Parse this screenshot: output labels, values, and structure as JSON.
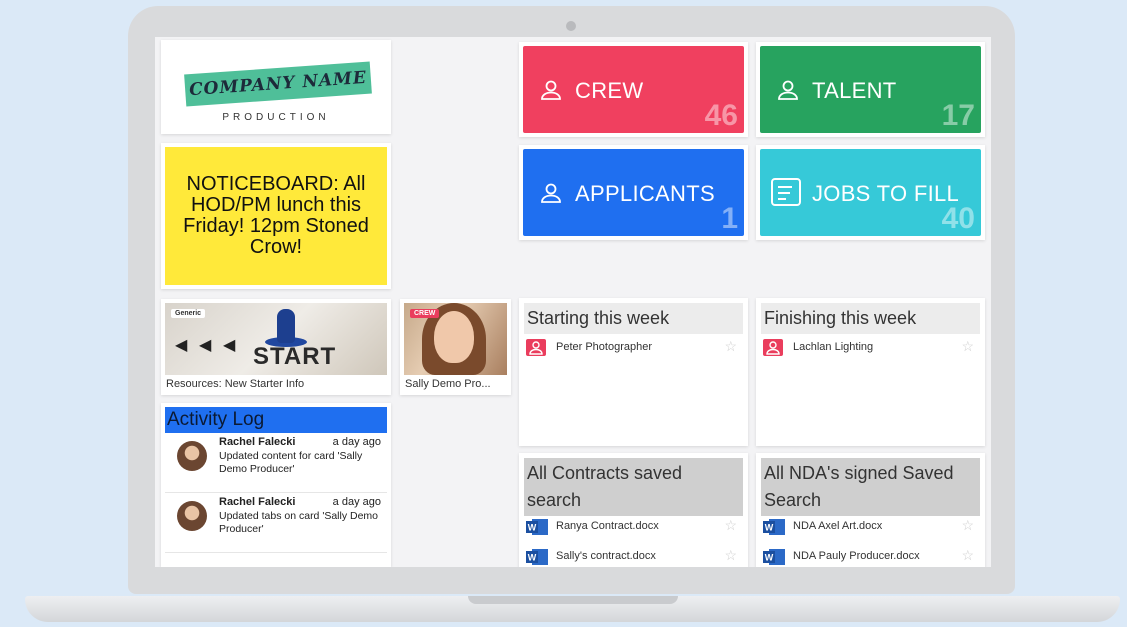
{
  "colors": {
    "crew": "#f0405f",
    "talent": "#27a35f",
    "applicants": "#1f6ff0",
    "jobs": "#36c9d8",
    "notice": "#ffe93a",
    "activity_header": "#1f6ff0",
    "logo_banner": "#4fbf99"
  },
  "logo": {
    "name": "COMPANY NAME",
    "subtitle": "PRODUCTION"
  },
  "notice": {
    "text": "NOTICEBOARD: All HOD/PM lunch this Friday! 12pm Stoned Crow!"
  },
  "tiles": [
    {
      "label": "CREW",
      "count": "46",
      "icon": "person-icon"
    },
    {
      "label": "TALENT",
      "count": "17",
      "icon": "person-icon"
    },
    {
      "label": "APPLICANTS",
      "count": "1",
      "icon": "person-icon"
    },
    {
      "label": "JOBS TO FILL",
      "count": "40",
      "icon": "list-icon"
    }
  ],
  "resource": {
    "tag": "Generic",
    "image_text": "START",
    "caption": "Resources: New Starter Info"
  },
  "crew_card": {
    "tag": "CREW",
    "caption": "Sally Demo Pro..."
  },
  "activity": {
    "title": "Activity Log",
    "entries": [
      {
        "name": "Rachel Falecki",
        "time": "a day ago",
        "text": "Updated content for card 'Sally Demo Producer'"
      },
      {
        "name": "Rachel Falecki",
        "time": "a day ago",
        "text": "Updated tabs on card 'Sally Demo Producer'"
      }
    ]
  },
  "starting": {
    "title": "Starting this week",
    "items": [
      {
        "label": "Peter Photographer"
      }
    ]
  },
  "finishing": {
    "title": "Finishing this week",
    "items": [
      {
        "label": "Lachlan Lighting"
      }
    ]
  },
  "contracts": {
    "title": "All Contracts saved search",
    "items": [
      {
        "label": "Ranya Contract.docx"
      },
      {
        "label": "Sally's contract.docx"
      }
    ]
  },
  "nda": {
    "title": "All NDA's signed Saved Search",
    "items": [
      {
        "label": "NDA Axel Art.docx"
      },
      {
        "label": "NDA Pauly Producer.docx"
      }
    ]
  }
}
